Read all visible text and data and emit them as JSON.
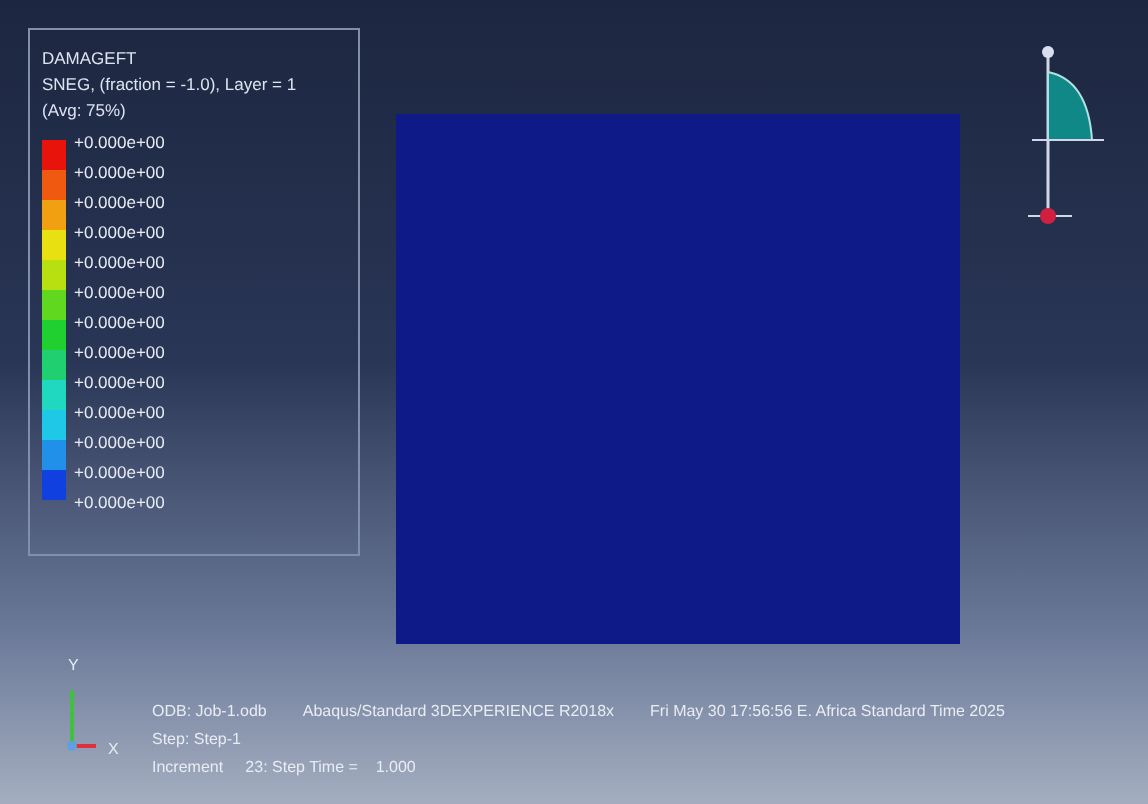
{
  "legend": {
    "title": "DAMAGEFT",
    "subtitle": "SNEG, (fraction = -1.0), Layer = 1",
    "average": "(Avg: 75%)",
    "swatches": [
      {
        "color": "#e8140c"
      },
      {
        "color": "#f05a10"
      },
      {
        "color": "#f0a010"
      },
      {
        "color": "#e8e010"
      },
      {
        "color": "#b8e010"
      },
      {
        "color": "#60d820"
      },
      {
        "color": "#20d030"
      },
      {
        "color": "#20d070"
      },
      {
        "color": "#20d8c0"
      },
      {
        "color": "#20c8e8"
      },
      {
        "color": "#2090e8"
      },
      {
        "color": "#1040e0"
      }
    ],
    "values": [
      "+0.000e+00",
      "+0.000e+00",
      "+0.000e+00",
      "+0.000e+00",
      "+0.000e+00",
      "+0.000e+00",
      "+0.000e+00",
      "+0.000e+00",
      "+0.000e+00",
      "+0.000e+00",
      "+0.000e+00",
      "+0.000e+00",
      "+0.000e+00"
    ]
  },
  "triad": {
    "y_label": "Y",
    "x_label": "X"
  },
  "info": {
    "odb": "ODB: Job-1.odb",
    "solver": "Abaqus/Standard 3DEXPERIENCE R2018x",
    "date": "Fri May 30 17:56:56 E. Africa Standard Time 2025",
    "step": "Step: Step-1",
    "increment": "Increment     23: Step Time =    1.000"
  }
}
